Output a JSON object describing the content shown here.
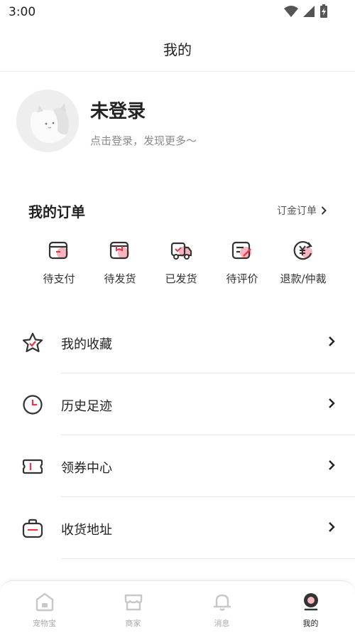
{
  "status_bar": {
    "time": "3:00"
  },
  "header": {
    "title": "我的"
  },
  "profile": {
    "name": "未登录",
    "hint": "点击登录，发现更多〜"
  },
  "orders": {
    "title": "我的订单",
    "link_label": "订金订单",
    "items": [
      {
        "label": "待支付",
        "icon": "wallet-icon"
      },
      {
        "label": "待发货",
        "icon": "box-icon"
      },
      {
        "label": "已发货",
        "icon": "truck-icon"
      },
      {
        "label": "待评价",
        "icon": "review-icon"
      },
      {
        "label": "退款/仲裁",
        "icon": "refund-icon"
      }
    ]
  },
  "menu": [
    {
      "label": "我的收藏",
      "icon": "star-icon"
    },
    {
      "label": "历史足迹",
      "icon": "clock-icon"
    },
    {
      "label": "领券中心",
      "icon": "coupon-icon"
    },
    {
      "label": "收货地址",
      "icon": "address-icon"
    }
  ],
  "tabs": [
    {
      "label": "宠物宝",
      "icon": "home-icon",
      "active": false
    },
    {
      "label": "商家",
      "icon": "shop-icon",
      "active": false
    },
    {
      "label": "消息",
      "icon": "bell-icon",
      "active": false
    },
    {
      "label": "我的",
      "icon": "profile-icon",
      "active": true
    }
  ],
  "colors": {
    "accent": "#e8344a",
    "accent_light": "#f7b5be",
    "icon_dark": "#333333"
  }
}
